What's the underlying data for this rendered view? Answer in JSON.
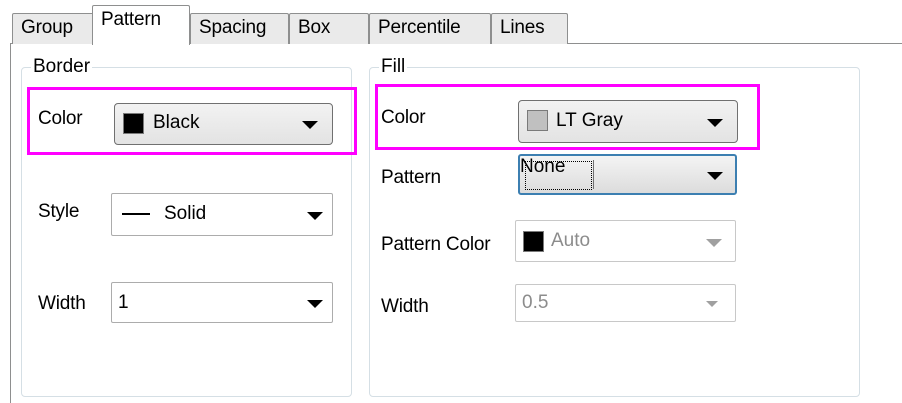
{
  "tabs": [
    {
      "label": "Group"
    },
    {
      "label": "Pattern"
    },
    {
      "label": "Spacing"
    },
    {
      "label": "Box"
    },
    {
      "label": "Percentile"
    },
    {
      "label": "Lines"
    }
  ],
  "active_tab": "Pattern",
  "border": {
    "title": "Border",
    "color_label": "Color",
    "color_value": "Black",
    "color_swatch": "#000000",
    "style_label": "Style",
    "style_value": "Solid",
    "width_label": "Width",
    "width_value": "1"
  },
  "fill": {
    "title": "Fill",
    "color_label": "Color",
    "color_value": "LT Gray",
    "color_swatch": "#c0c0c0",
    "pattern_label": "Pattern",
    "pattern_value": "None",
    "pattern_color_label": "Pattern Color",
    "pattern_color_value": "Auto",
    "pattern_color_swatch": "#000000",
    "width_label": "Width",
    "width_value": "0.5"
  },
  "colors": {
    "highlight": "#ff00ff",
    "focus": "#3c7fb1"
  }
}
